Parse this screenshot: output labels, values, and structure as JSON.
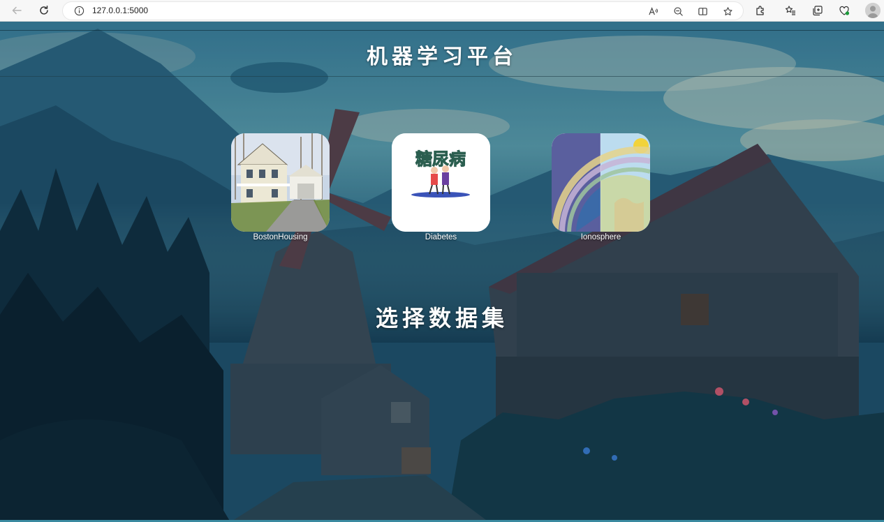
{
  "browser": {
    "url": "127.0.0.1:5000"
  },
  "page": {
    "title": "机器学习平台",
    "subtitle": "选择数据集",
    "datasets": [
      {
        "label": "BostonHousing",
        "icon": "house-photo-icon"
      },
      {
        "label": "Diabetes",
        "icon": "diabetes-illustration-icon"
      },
      {
        "label": "Ionosphere",
        "icon": "ionosphere-diagram-icon"
      }
    ],
    "thumb_text": {
      "diabetes_glyph": "糖尿病"
    }
  },
  "colors": {
    "accent": "#3a8aa0",
    "chrome_bg": "#f7f7f7"
  }
}
